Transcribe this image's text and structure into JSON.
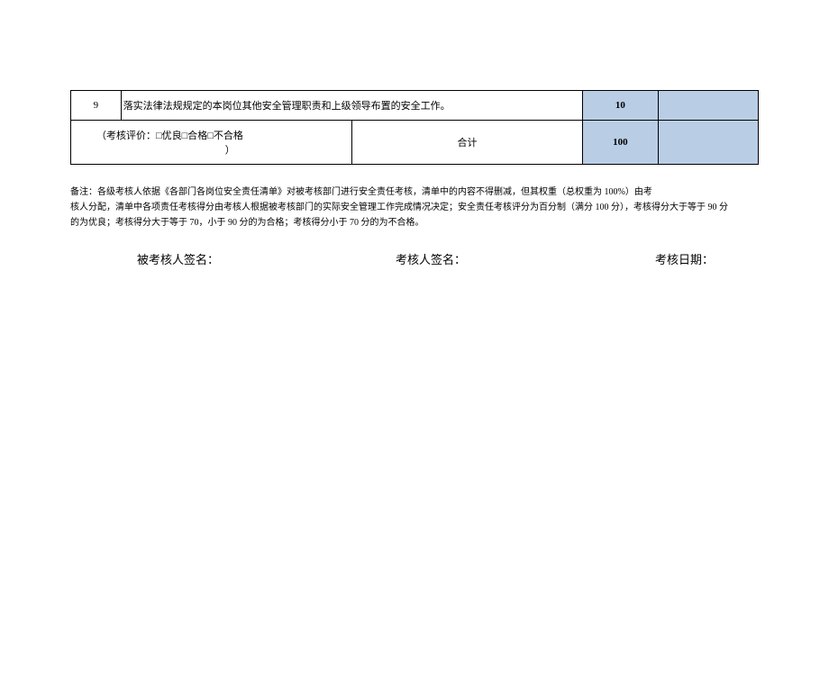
{
  "table": {
    "row9": {
      "index": "9",
      "desc": "落实法律法规规定的本岗位其他安全管理职责和上级领导布置的安全工作。",
      "score": "10"
    },
    "eval": {
      "left": "（考核评价：□优良□合格□不合格",
      "paren": "）",
      "sub_label": "合计",
      "total": "100"
    }
  },
  "notes": {
    "line1": "备注：各级考核人依据《各部门各岗位安全责任清单》对被考核部门进行安全责任考核，清单中的内容不得删减，但其权重（总权重为 100%）由考",
    "line2": "核人分配，清单中各项责任考核得分由考核人根据被考核部门的实际安全管理工作完成情况决定；安全责任考核评分为百分制（满分 100 分），考核得分大于等于 90 分",
    "line3": "的为优良；考核得分大于等于 70，小于 90 分的为合格；考核得分小于 70 分的为不合格。"
  },
  "signatures": {
    "assessee": "被考核人签名：",
    "assessor": "考核人签名：",
    "date": "考核日期："
  }
}
